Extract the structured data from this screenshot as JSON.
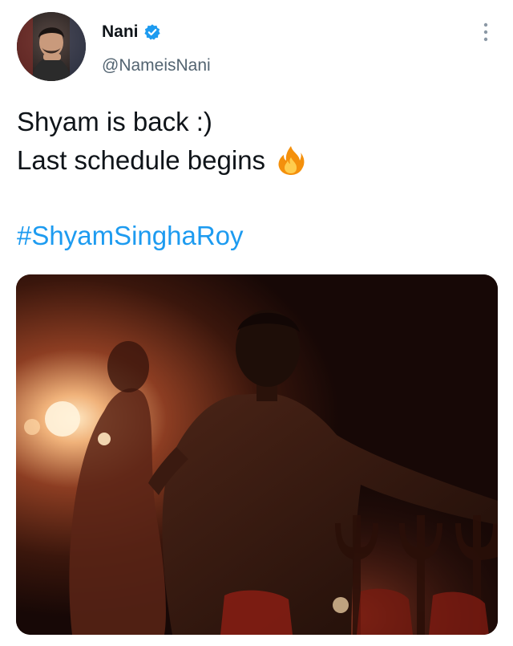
{
  "tweet": {
    "author": {
      "display_name": "Nani",
      "handle": "@NameisNani",
      "verified": true,
      "avatar_icon": "profile-photo"
    },
    "more_icon": "more-vertical-icon",
    "text_lines": [
      "Shyam is back :)",
      "Last schedule begins"
    ],
    "emoji": "fire-emoji",
    "hashtag": "#ShyamSinghaRoy",
    "media": {
      "type": "photo",
      "description_icon": "movie-still-image"
    }
  },
  "colors": {
    "text": "#0f1419",
    "secondary": "#536471",
    "link": "#1d9bf0",
    "verified": "#1d9bf0"
  }
}
